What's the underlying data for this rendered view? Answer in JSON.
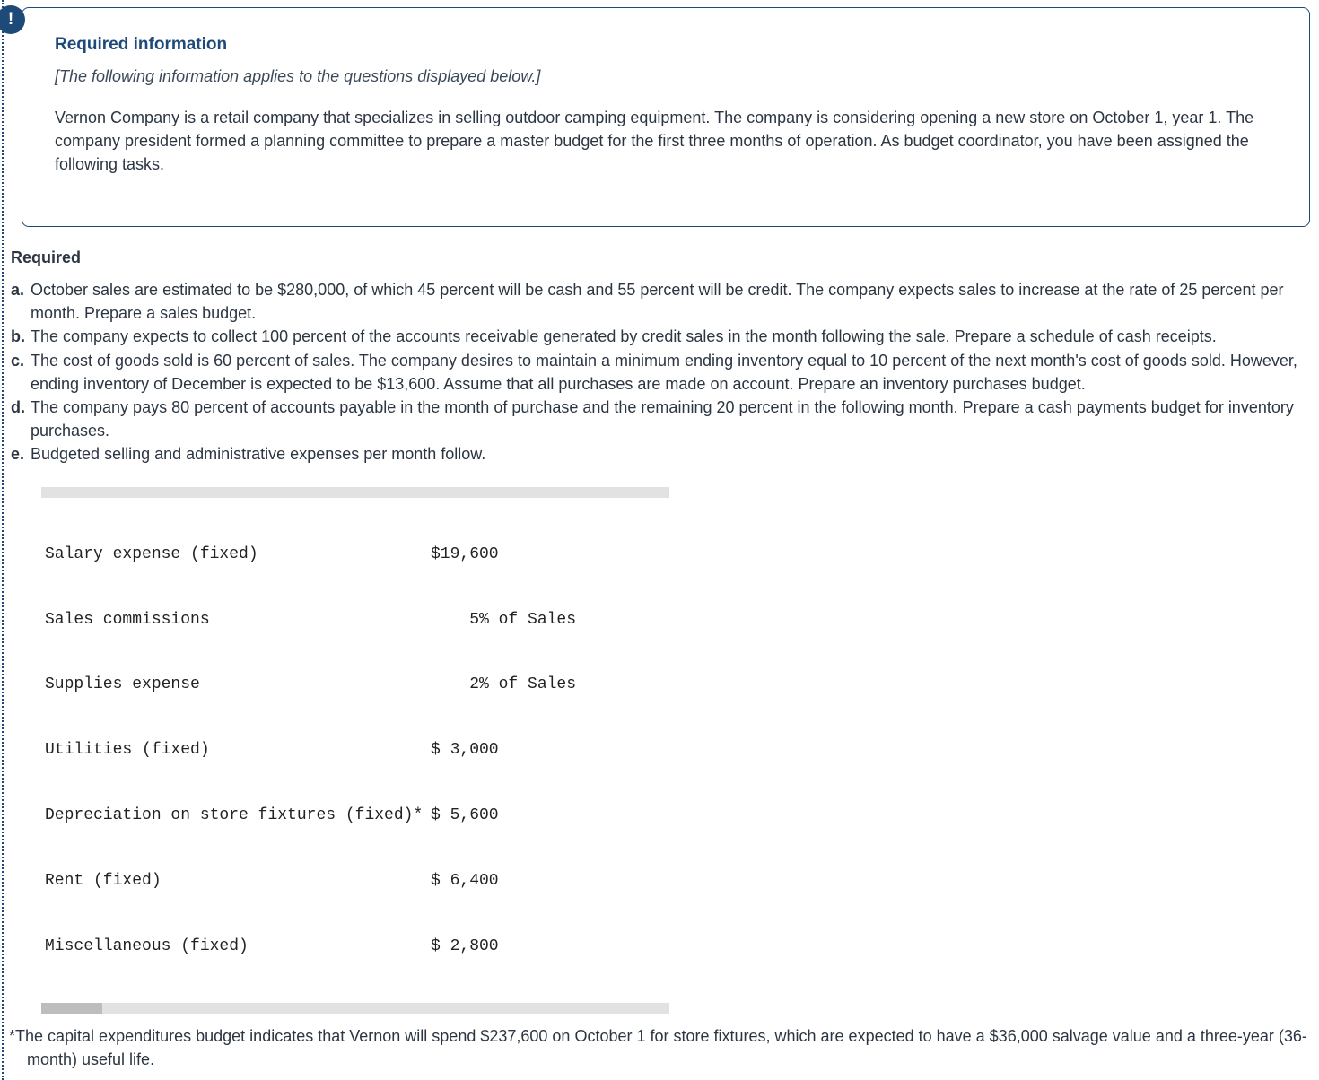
{
  "badge": {
    "glyph": "!"
  },
  "box": {
    "title": "Required information",
    "applies": "[The following information applies to the questions displayed below.]",
    "paragraph": "Vernon Company is a retail company that specializes in selling outdoor camping equipment. The company is considering opening a new store on October 1, year 1. The company president formed a planning committee to prepare a master budget for the first three months of operation. As budget coordinator, you have been assigned the following tasks."
  },
  "required_heading": "Required",
  "items": [
    {
      "marker": "a.",
      "text": "October sales are estimated to be $280,000, of which 45 percent will be cash and 55 percent will be credit. The company expects sales to increase at the rate of 25 percent per month. Prepare a sales budget."
    },
    {
      "marker": "b.",
      "text": "The company expects to collect 100 percent of the accounts receivable generated by credit sales in the month following the sale. Prepare a schedule of cash receipts."
    },
    {
      "marker": "c.",
      "text": "The cost of goods sold is 60 percent of sales. The company desires to maintain a minimum ending inventory equal to 10 percent of the next month's cost of goods sold. However, ending inventory of December is expected to be $13,600. Assume that all purchases are made on account. Prepare an inventory purchases budget."
    },
    {
      "marker": "d.",
      "text": "The company pays 80 percent of accounts payable in the month of purchase and the remaining 20 percent in the following month. Prepare a cash payments budget for inventory purchases."
    },
    {
      "marker": "e.",
      "text": "Budgeted selling and administrative expenses per month follow."
    }
  ],
  "expenses": [
    {
      "label": "Salary expense (fixed)",
      "value": "$19,600"
    },
    {
      "label": "Sales commissions",
      "value": "    5% of Sales"
    },
    {
      "label": "Supplies expense",
      "value": "    2% of Sales"
    },
    {
      "label": "Utilities (fixed)",
      "value": "$ 3,000"
    },
    {
      "label": "Depreciation on store fixtures (fixed)*",
      "value": "$ 5,600"
    },
    {
      "label": "Rent (fixed)",
      "value": "$ 6,400"
    },
    {
      "label": "Miscellaneous (fixed)",
      "value": "$ 2,800"
    }
  ],
  "footnote": "*The capital expenditures budget indicates that Vernon will spend $237,600 on October 1 for store fixtures, which are expected to have a $36,000 salvage value and a three-year (36-month) useful life."
}
